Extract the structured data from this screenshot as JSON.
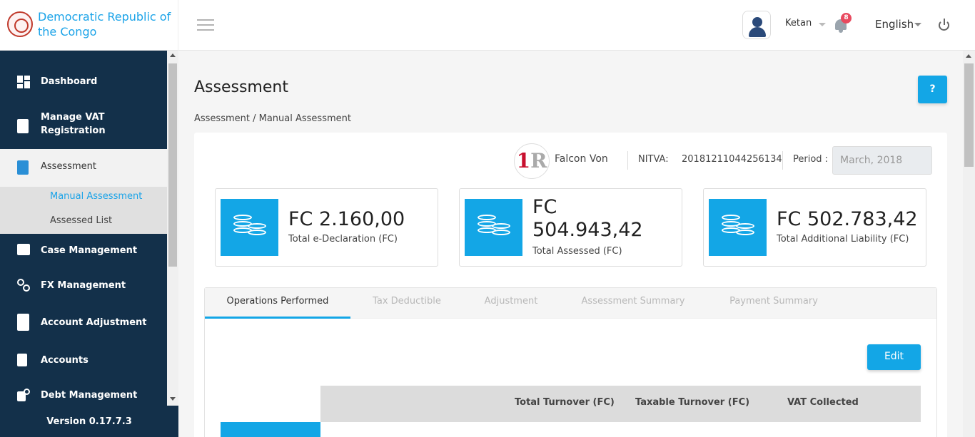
{
  "header": {
    "brand_name": "Democratic Republic of the Congo",
    "username": "Ketan",
    "notification_count": "8",
    "language": "English"
  },
  "sidebar": {
    "items": [
      {
        "label": "Dashboard",
        "icon": "dashboard-icon"
      },
      {
        "label": "Manage VAT Registration",
        "icon": "clipboard-icon"
      },
      {
        "label": "Assessment",
        "icon": "document-search-icon",
        "active": true
      },
      {
        "label": "Case Management",
        "icon": "folder-icon"
      },
      {
        "label": "FX Management",
        "icon": "currency-exchange-icon"
      },
      {
        "label": "Account Adjustment",
        "icon": "calculator-icon"
      },
      {
        "label": "Accounts",
        "icon": "receipt-icon"
      },
      {
        "label": "Debt Management",
        "icon": "debt-icon"
      }
    ],
    "subitems": [
      {
        "label": "Manual Assessment",
        "active": true
      },
      {
        "label": "Assessed List"
      }
    ],
    "version": "Version 0.17.7.3"
  },
  "page": {
    "title": "Assessment",
    "help_label": "?",
    "breadcrumb": "Assessment / Manual Assessment"
  },
  "taxpayer": {
    "logo_text_1": "1",
    "logo_text_2": "R",
    "name": "Falcon Von",
    "nitva_label": "NITVA:",
    "nitva_value": "20181211044256134",
    "period_label": "Period :",
    "period_value": "March, 2018"
  },
  "stats": [
    {
      "amount": "FC 2.160,00",
      "caption": "Total e-Declaration (FC)"
    },
    {
      "amount": "FC 504.943,42",
      "caption": "Total Assessed (FC)"
    },
    {
      "amount": "FC 502.783,42",
      "caption": "Total Additional Liability (FC)"
    }
  ],
  "tabs": [
    {
      "label": "Operations Performed",
      "active": true
    },
    {
      "label": "Tax Deductible"
    },
    {
      "label": "Adjustment"
    },
    {
      "label": "Assessment Summary"
    },
    {
      "label": "Payment Summary"
    }
  ],
  "actions": {
    "edit_label": "Edit"
  },
  "table": {
    "headers": [
      "Total Turnover (FC)",
      "Taxable Turnover (FC)",
      "VAT Collected"
    ]
  },
  "colors": {
    "accent": "#13a6e6",
    "sidebar": "#13304a",
    "brand": "#1aa3e8",
    "badge": "#e84a5f"
  }
}
